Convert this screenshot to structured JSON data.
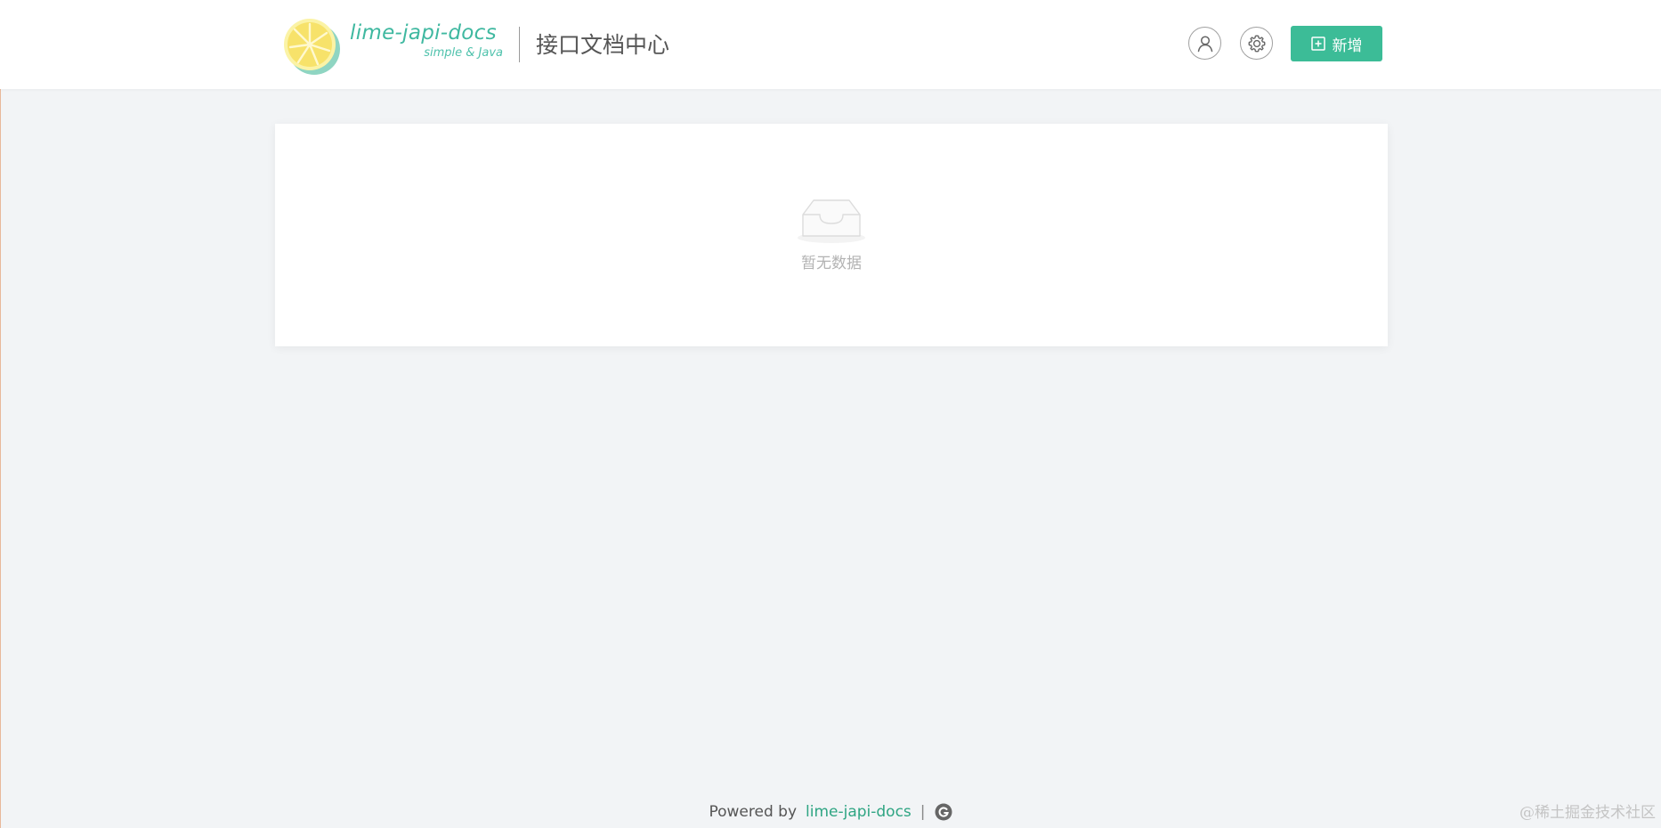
{
  "header": {
    "brand_name": "lime-japi-docs",
    "brand_tagline": "simple & Java",
    "page_title": "接口文档中心",
    "add_button_label": "新增",
    "user_button_icon": "user-icon",
    "settings_button_icon": "gear-icon"
  },
  "main": {
    "empty_text": "暂无数据",
    "empty_icon": "inbox-icon"
  },
  "footer": {
    "powered_by": "Powered by",
    "link_text": "lime-japi-docs",
    "separator": "|",
    "github_icon": "github-icon"
  },
  "watermark": "@稀土掘金技术社区",
  "colors": {
    "accent": "#3cbc97",
    "brand_text": "#3fb8a0",
    "background": "#f2f4f6",
    "empty_text": "#b3b3b3"
  }
}
